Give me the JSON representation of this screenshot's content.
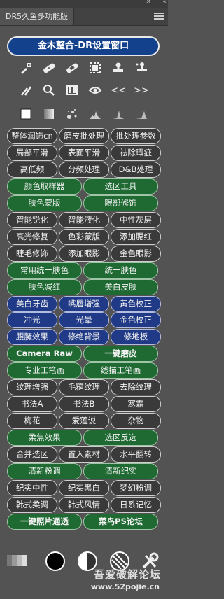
{
  "panel": {
    "tab_label": "DR5久鱼多功能版"
  },
  "header": {
    "button_label": "金木整合-DR设置窗口"
  },
  "tools_row1": [
    "brush-plus-icon",
    "bandage-icon",
    "bandage-alt-icon",
    "selection-rect-icon",
    "stamp-icon",
    "stamp-multi-icon"
  ],
  "tools_row2": [
    "brushes-icon",
    "magnifier-icon",
    "split-view-icon",
    "eye-icon",
    "prev-icon",
    "next-icon"
  ],
  "tools_row2_labels": {
    "prev": "<<",
    "next": ">>"
  },
  "tools_row3": [
    "white-square-icon",
    "gradient-square-icon",
    "sparkle-dots-icon",
    "histogram-icon",
    "histogram-small-icon",
    "histogram-right-icon"
  ],
  "buttons": [
    [
      "整体润饰cn",
      "磨皮批处理",
      "批处理参数"
    ],
    [
      "局部平滑",
      "表面平滑",
      "祛除瑕疵"
    ],
    [
      "高低频",
      "分频处理",
      "D&B处理"
    ],
    [
      "颜色取样器",
      "选区工具"
    ],
    [
      "肤色蒙版",
      "眼部修饰"
    ],
    [
      "智能锐化",
      "智能液化",
      "中性灰层"
    ],
    [
      "高光修复",
      "色彩蒙版",
      "添加腮红"
    ],
    [
      "睫毛修饰",
      "添加眼影",
      "金色眼影"
    ],
    [
      "常用统一肤色",
      "统一肤色"
    ],
    [
      "肤色减红",
      "美白皮肤"
    ],
    [
      "美白牙齿",
      "嘴唇增强",
      "黄色校正"
    ],
    [
      "冲光",
      "光晕",
      "金色校正"
    ],
    [
      "腰臃效果",
      "修绝背景",
      "修地板"
    ],
    [
      "Camera Raw",
      "一键磨皮"
    ],
    [
      "专业工笔画",
      "线描工笔画"
    ],
    [
      "纹理增强",
      "毛糙纹理",
      "去除纹理"
    ],
    [
      "书法A",
      "书法B",
      "寒霜"
    ],
    [
      "梅花",
      "爱莲说",
      "杂物"
    ],
    [
      "柔焦效果",
      "选区反选"
    ],
    [
      "合并选区",
      "置入素材",
      "水平翻转"
    ],
    [
      "清新粉调",
      "清新纪实"
    ],
    [
      "纪实中性",
      "纪实黑白",
      "梦幻粉调"
    ],
    [
      "韩式柔调",
      "韩式风情",
      "日系记忆"
    ],
    [
      "一键照片通透",
      "菜鸟PS论坛"
    ]
  ],
  "bottom_tools": [
    "gray-steps-icon",
    "black-circle-icon",
    "half-circle-icon",
    "striped-circle-icon",
    "tools-icon"
  ],
  "watermark": {
    "text": "吾爱破解论坛",
    "url": "www.52pojie.cn"
  },
  "colors": {
    "green": "#1f6a32",
    "blue": "#203a87",
    "dark": "#3a3a3a",
    "header_blue": "#14418c"
  }
}
